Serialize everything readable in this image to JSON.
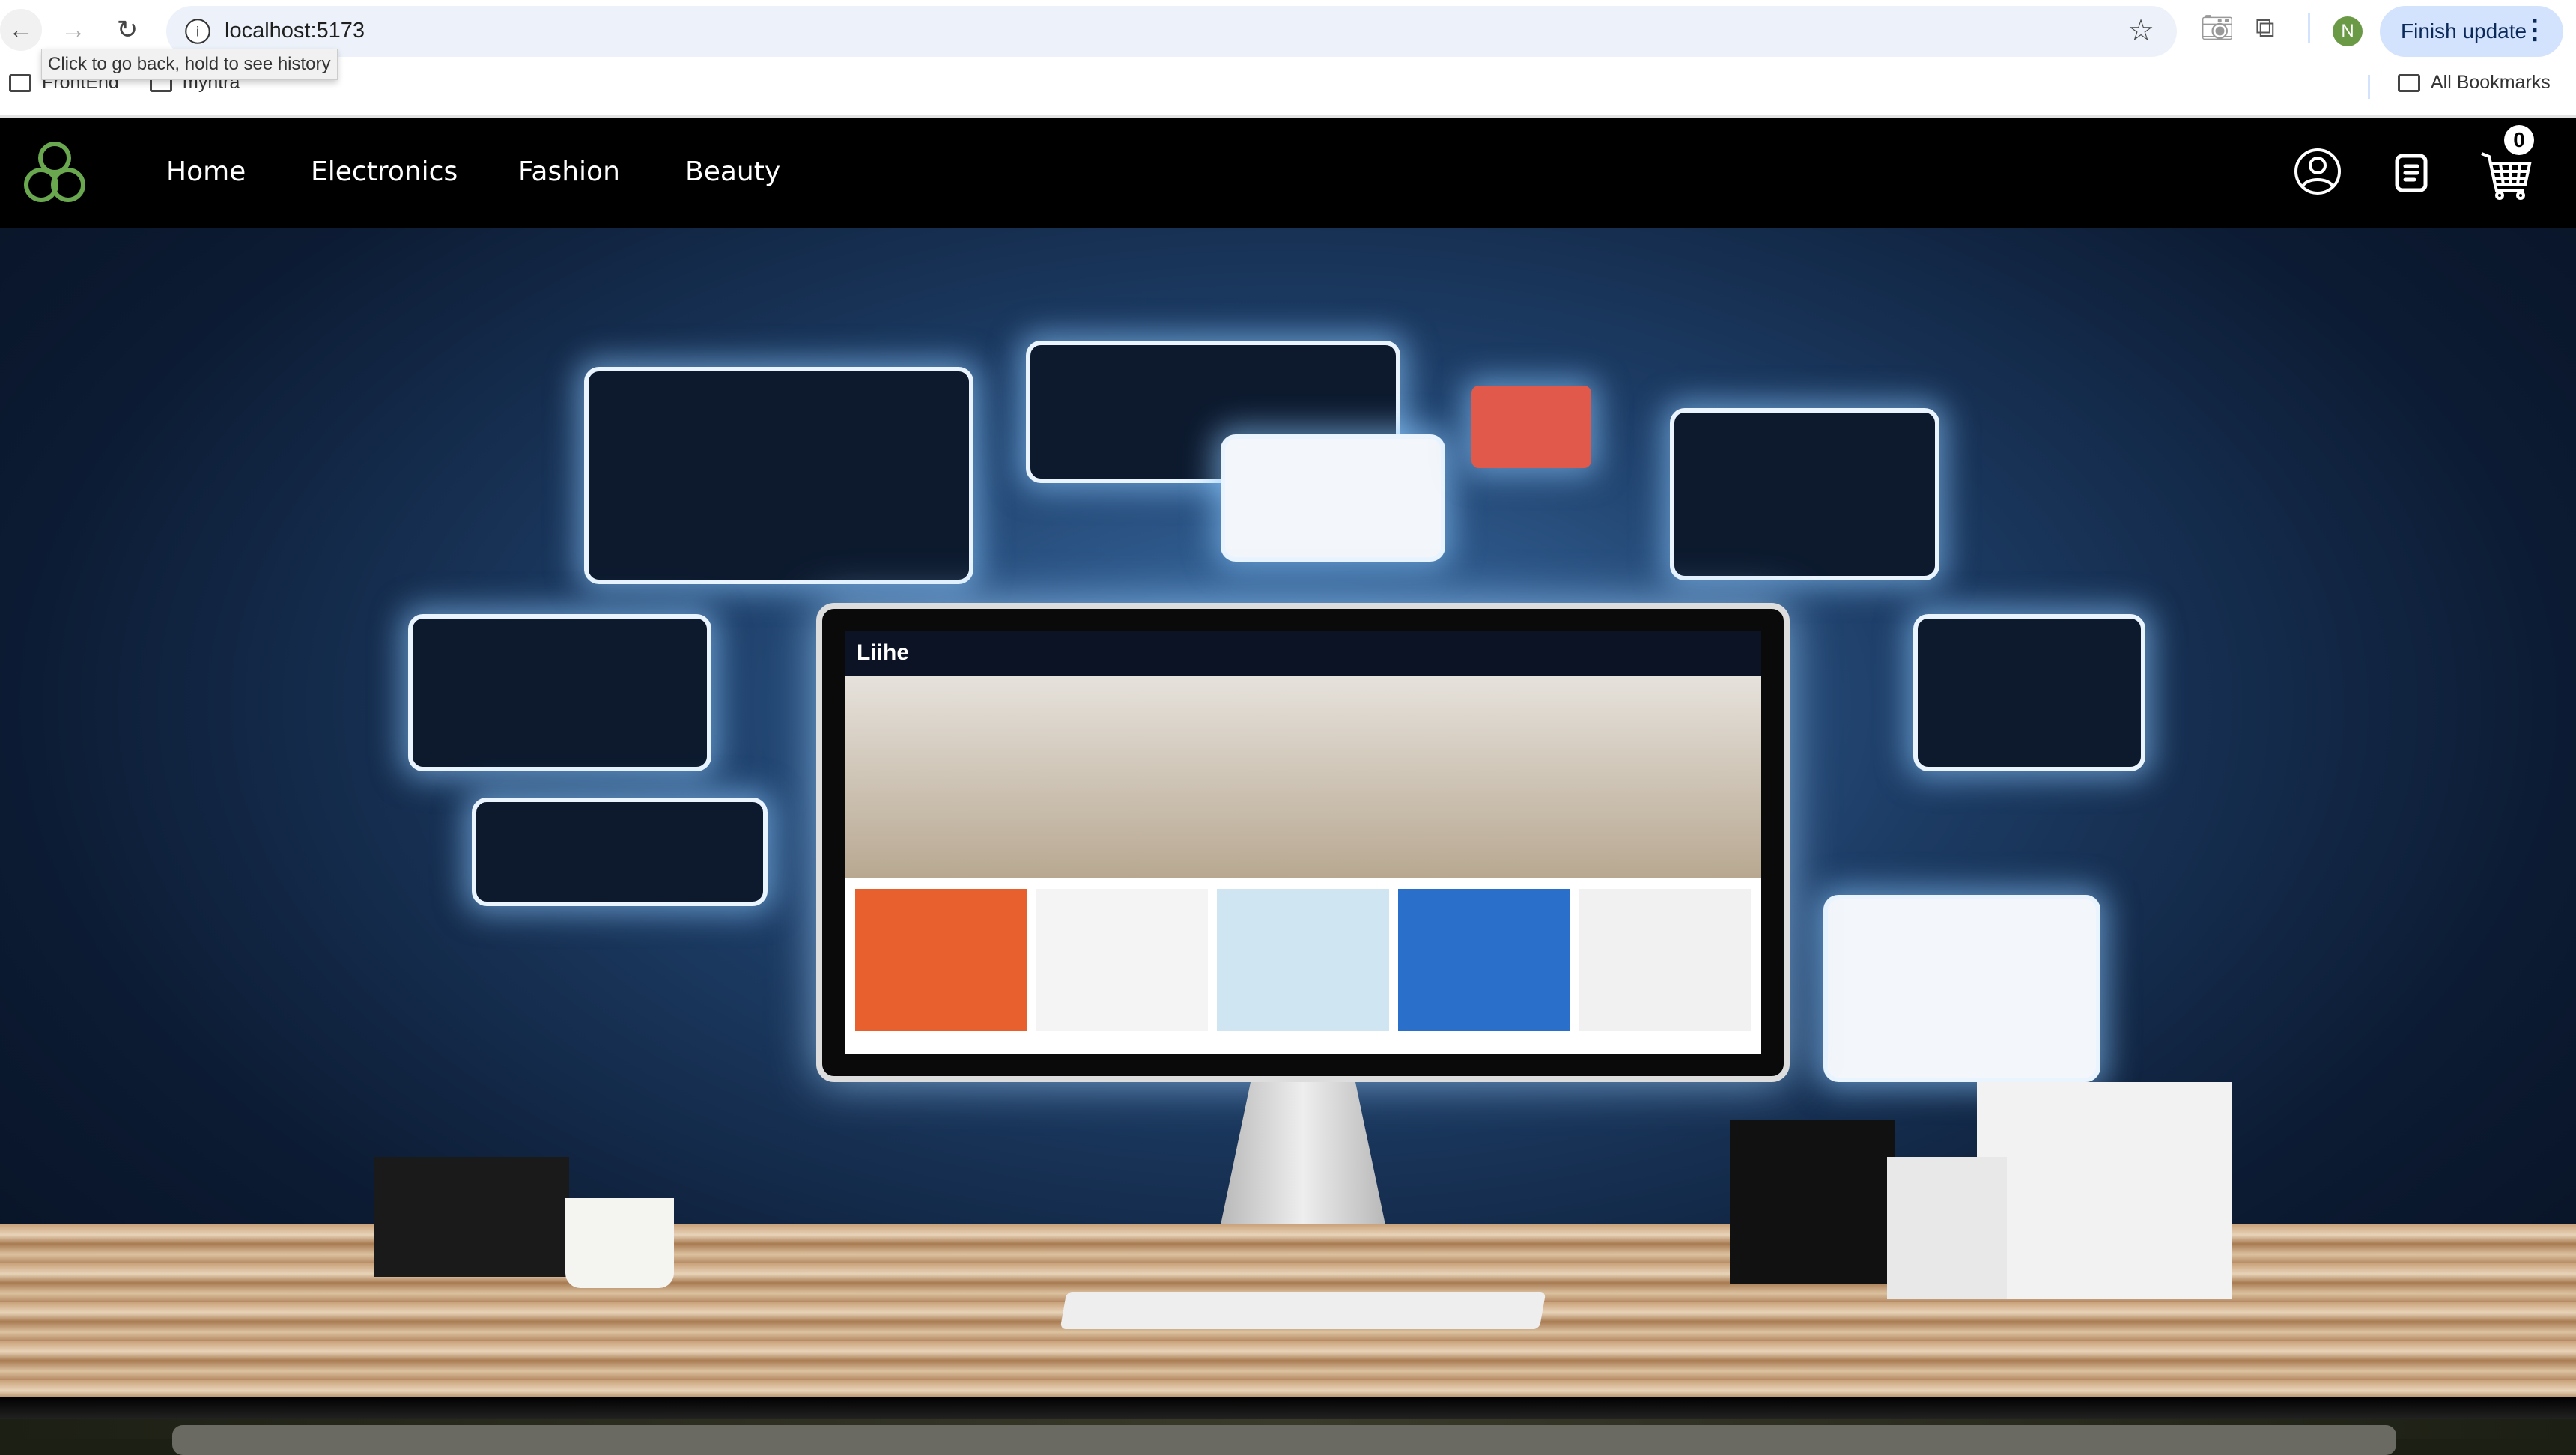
{
  "browser": {
    "url": "localhost:5173",
    "tooltip": "Click to go back, hold to see history",
    "bookmarks": [
      {
        "label": "FrontEnd",
        "icon": "folder-icon"
      },
      {
        "label": "myntra",
        "icon": "folder-icon"
      }
    ],
    "all_bookmarks": "All Bookmarks",
    "profile_initial": "N",
    "finish_update": "Finish update",
    "accent": "#d3e3fd"
  },
  "nav": {
    "logo_color": "#6aa84f",
    "links": [
      "Home",
      "Electronics",
      "Fashion",
      "Beauty"
    ],
    "cart_count": "0",
    "icons": [
      "user-circle-icon",
      "orders-list-icon",
      "cart-icon"
    ]
  },
  "hero": {
    "screen_brand": "Liihe"
  }
}
